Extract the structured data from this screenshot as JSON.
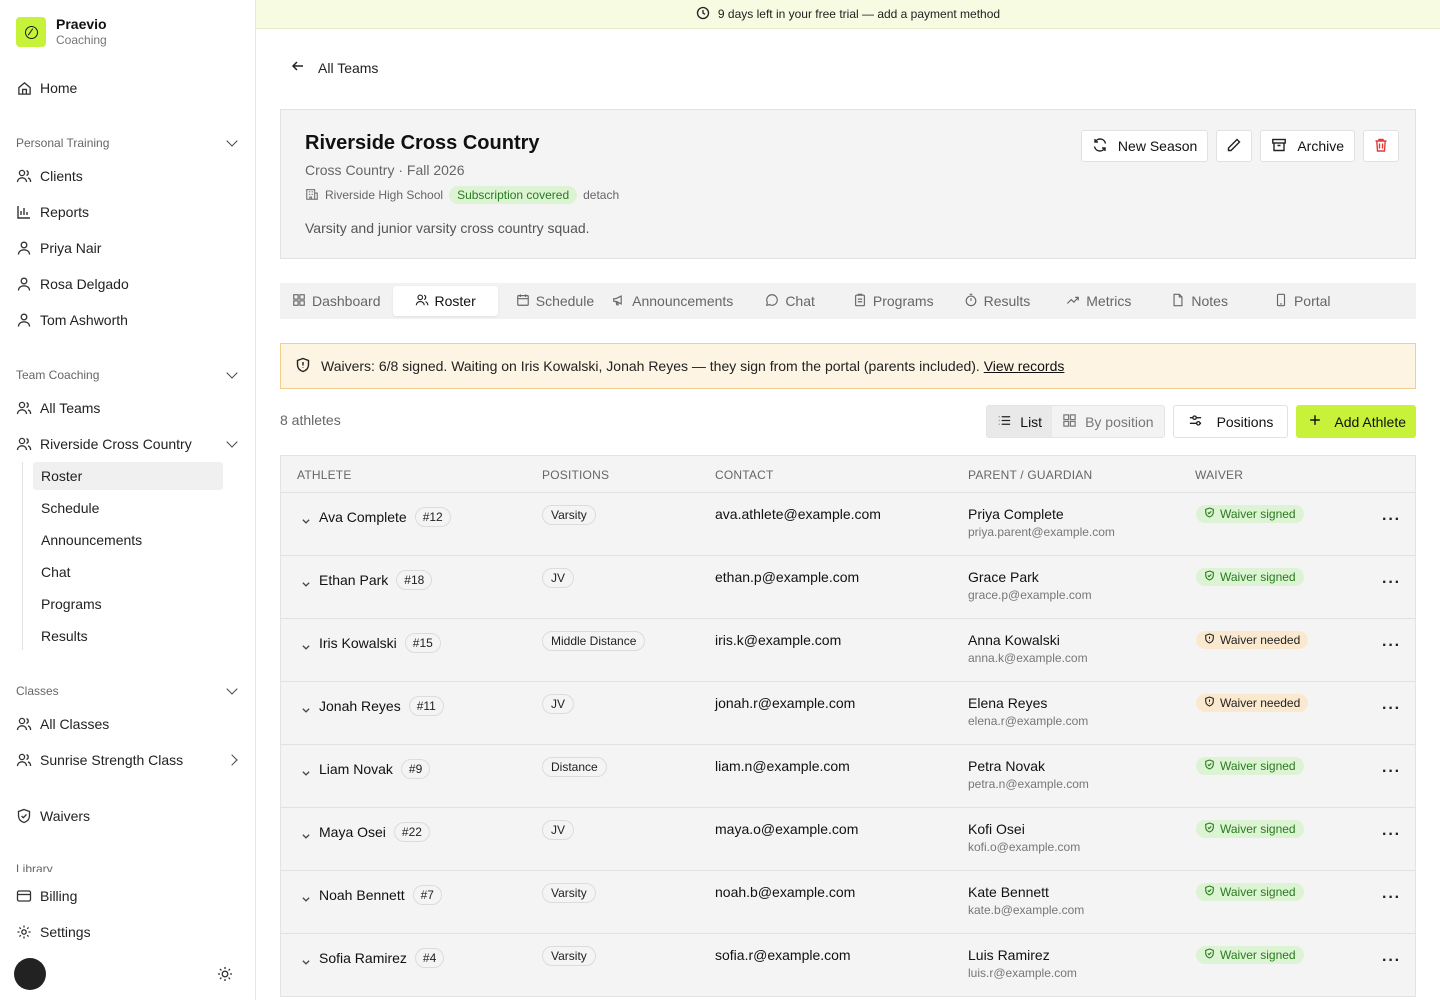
{
  "brand": {
    "name": "Praevio",
    "sub": "Coaching"
  },
  "banner": {
    "text": "9 days left in your free trial — add a payment method"
  },
  "nav": {
    "home": "Home",
    "personal_training": {
      "label": "Personal Training",
      "items": [
        "Clients",
        "Reports",
        "Priya Nair",
        "Rosa Delgado",
        "Tom Ashworth"
      ]
    },
    "team_coaching": {
      "label": "Team Coaching",
      "all_teams": "All Teams",
      "team": "Riverside Cross Country",
      "sub_items": [
        "Roster",
        "Schedule",
        "Announcements",
        "Chat",
        "Programs",
        "Results"
      ]
    },
    "classes": {
      "label": "Classes",
      "all_classes": "All Classes",
      "sunrise": "Sunrise Strength Class"
    },
    "waivers": "Waivers",
    "library": "Library",
    "billing": "Billing",
    "settings": "Settings"
  },
  "back": "All Teams",
  "team": {
    "title": "Riverside Cross Country",
    "meta": "Cross Country · Fall 2026",
    "org": "Riverside High School",
    "org_badge": "Subscription covered",
    "detach": "detach",
    "description": "Varsity and junior varsity cross country squad."
  },
  "actions": {
    "new_season": "New Season",
    "archive": "Archive"
  },
  "tabs": [
    "Dashboard",
    "Roster",
    "Schedule",
    "Announcements",
    "Chat",
    "Programs",
    "Results",
    "Metrics",
    "Notes",
    "Portal"
  ],
  "alert": {
    "text": "Waivers: 6/8 signed. Waiting on Iris Kowalski, Jonah Reyes — they sign from the portal (parents included).",
    "link": "View records"
  },
  "toolbar": {
    "count": "8 athletes",
    "list": "List",
    "by_position": "By position",
    "positions": "Positions",
    "add": "Add Athlete"
  },
  "columns": [
    "ATHLETE",
    "POSITIONS",
    "CONTACT",
    "PARENT / GUARDIAN",
    "WAIVER"
  ],
  "athletes": [
    {
      "name": "Ava Complete",
      "number": "#12",
      "position": "Varsity",
      "email": "ava.athlete@example.com",
      "parent": "Priya Complete",
      "parent_email": "priya.parent@example.com",
      "waiver": "Waiver signed",
      "signed": true
    },
    {
      "name": "Ethan Park",
      "number": "#18",
      "position": "JV",
      "email": "ethan.p@example.com",
      "parent": "Grace Park",
      "parent_email": "grace.p@example.com",
      "waiver": "Waiver signed",
      "signed": true
    },
    {
      "name": "Iris Kowalski",
      "number": "#15",
      "position": "Middle Distance",
      "email": "iris.k@example.com",
      "parent": "Anna Kowalski",
      "parent_email": "anna.k@example.com",
      "waiver": "Waiver needed",
      "signed": false
    },
    {
      "name": "Jonah Reyes",
      "number": "#11",
      "position": "JV",
      "email": "jonah.r@example.com",
      "parent": "Elena Reyes",
      "parent_email": "elena.r@example.com",
      "waiver": "Waiver needed",
      "signed": false
    },
    {
      "name": "Liam Novak",
      "number": "#9",
      "position": "Distance",
      "email": "liam.n@example.com",
      "parent": "Petra Novak",
      "parent_email": "petra.n@example.com",
      "waiver": "Waiver signed",
      "signed": true
    },
    {
      "name": "Maya Osei",
      "number": "#22",
      "position": "JV",
      "email": "maya.o@example.com",
      "parent": "Kofi Osei",
      "parent_email": "kofi.o@example.com",
      "waiver": "Waiver signed",
      "signed": true
    },
    {
      "name": "Noah Bennett",
      "number": "#7",
      "position": "Varsity",
      "email": "noah.b@example.com",
      "parent": "Kate Bennett",
      "parent_email": "kate.b@example.com",
      "waiver": "Waiver signed",
      "signed": true
    },
    {
      "name": "Sofia Ramirez",
      "number": "#4",
      "position": "Varsity",
      "email": "sofia.r@example.com",
      "parent": "Luis Ramirez",
      "parent_email": "luis.r@example.com",
      "waiver": "Waiver signed",
      "signed": true
    }
  ],
  "colors": {
    "accent": "#c8f23a",
    "signed_bg": "#dcf3d4",
    "signed_fg": "#2a7a1f",
    "needed_bg": "#fbe9cf",
    "alert_bg": "#fdf4e3"
  }
}
